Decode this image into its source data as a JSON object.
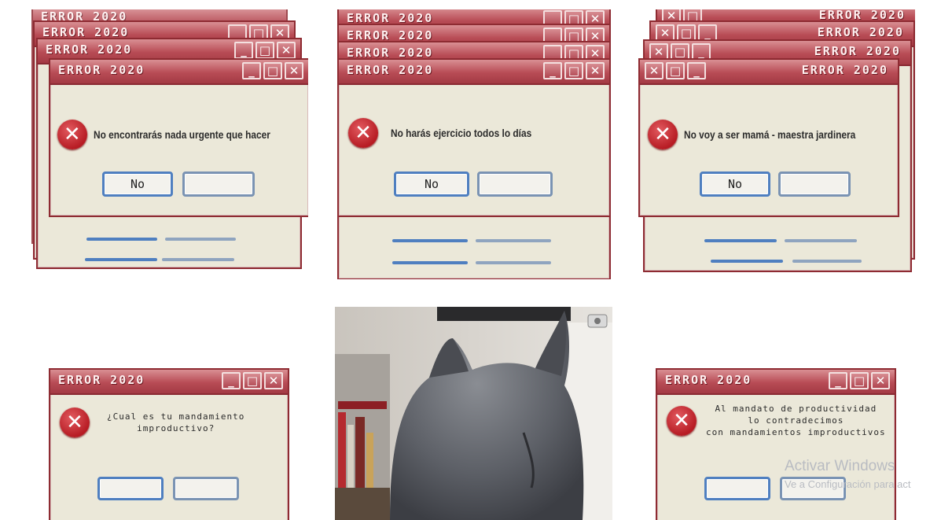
{
  "error_title": "ERROR 2020",
  "controls": {
    "minimize": "_",
    "maximize": "□",
    "close": "✕"
  },
  "panels": [
    {
      "message": "No encontrarás nada urgente que hacer",
      "button_primary": "No",
      "button_secondary": ""
    },
    {
      "message": "No harás ejercicio todos lo días",
      "button_primary": "No",
      "button_secondary": ""
    },
    {
      "message": "No voy a ser mamá - maestra jardinera",
      "button_primary": "No",
      "button_secondary": ""
    },
    {
      "message": "¿Cual es tu mandamiento\nimproductivo?",
      "button_primary": "",
      "button_secondary": ""
    },
    {
      "message": "Al mandato de productividad\nlo contradecimos\ncon mandamientos improductivos",
      "button_primary": "",
      "button_secondary": ""
    }
  ],
  "watermark": {
    "line1": "Activar Windows",
    "line2": "Ve a Configuración para act"
  },
  "icons": {
    "error": "error-x-icon",
    "cat": "cat-photo"
  },
  "colors": {
    "titlebar": "#b84c55",
    "window_bg": "#ebe8d9",
    "button_border": "#4f7fc0",
    "error_icon": "#c0252c"
  }
}
